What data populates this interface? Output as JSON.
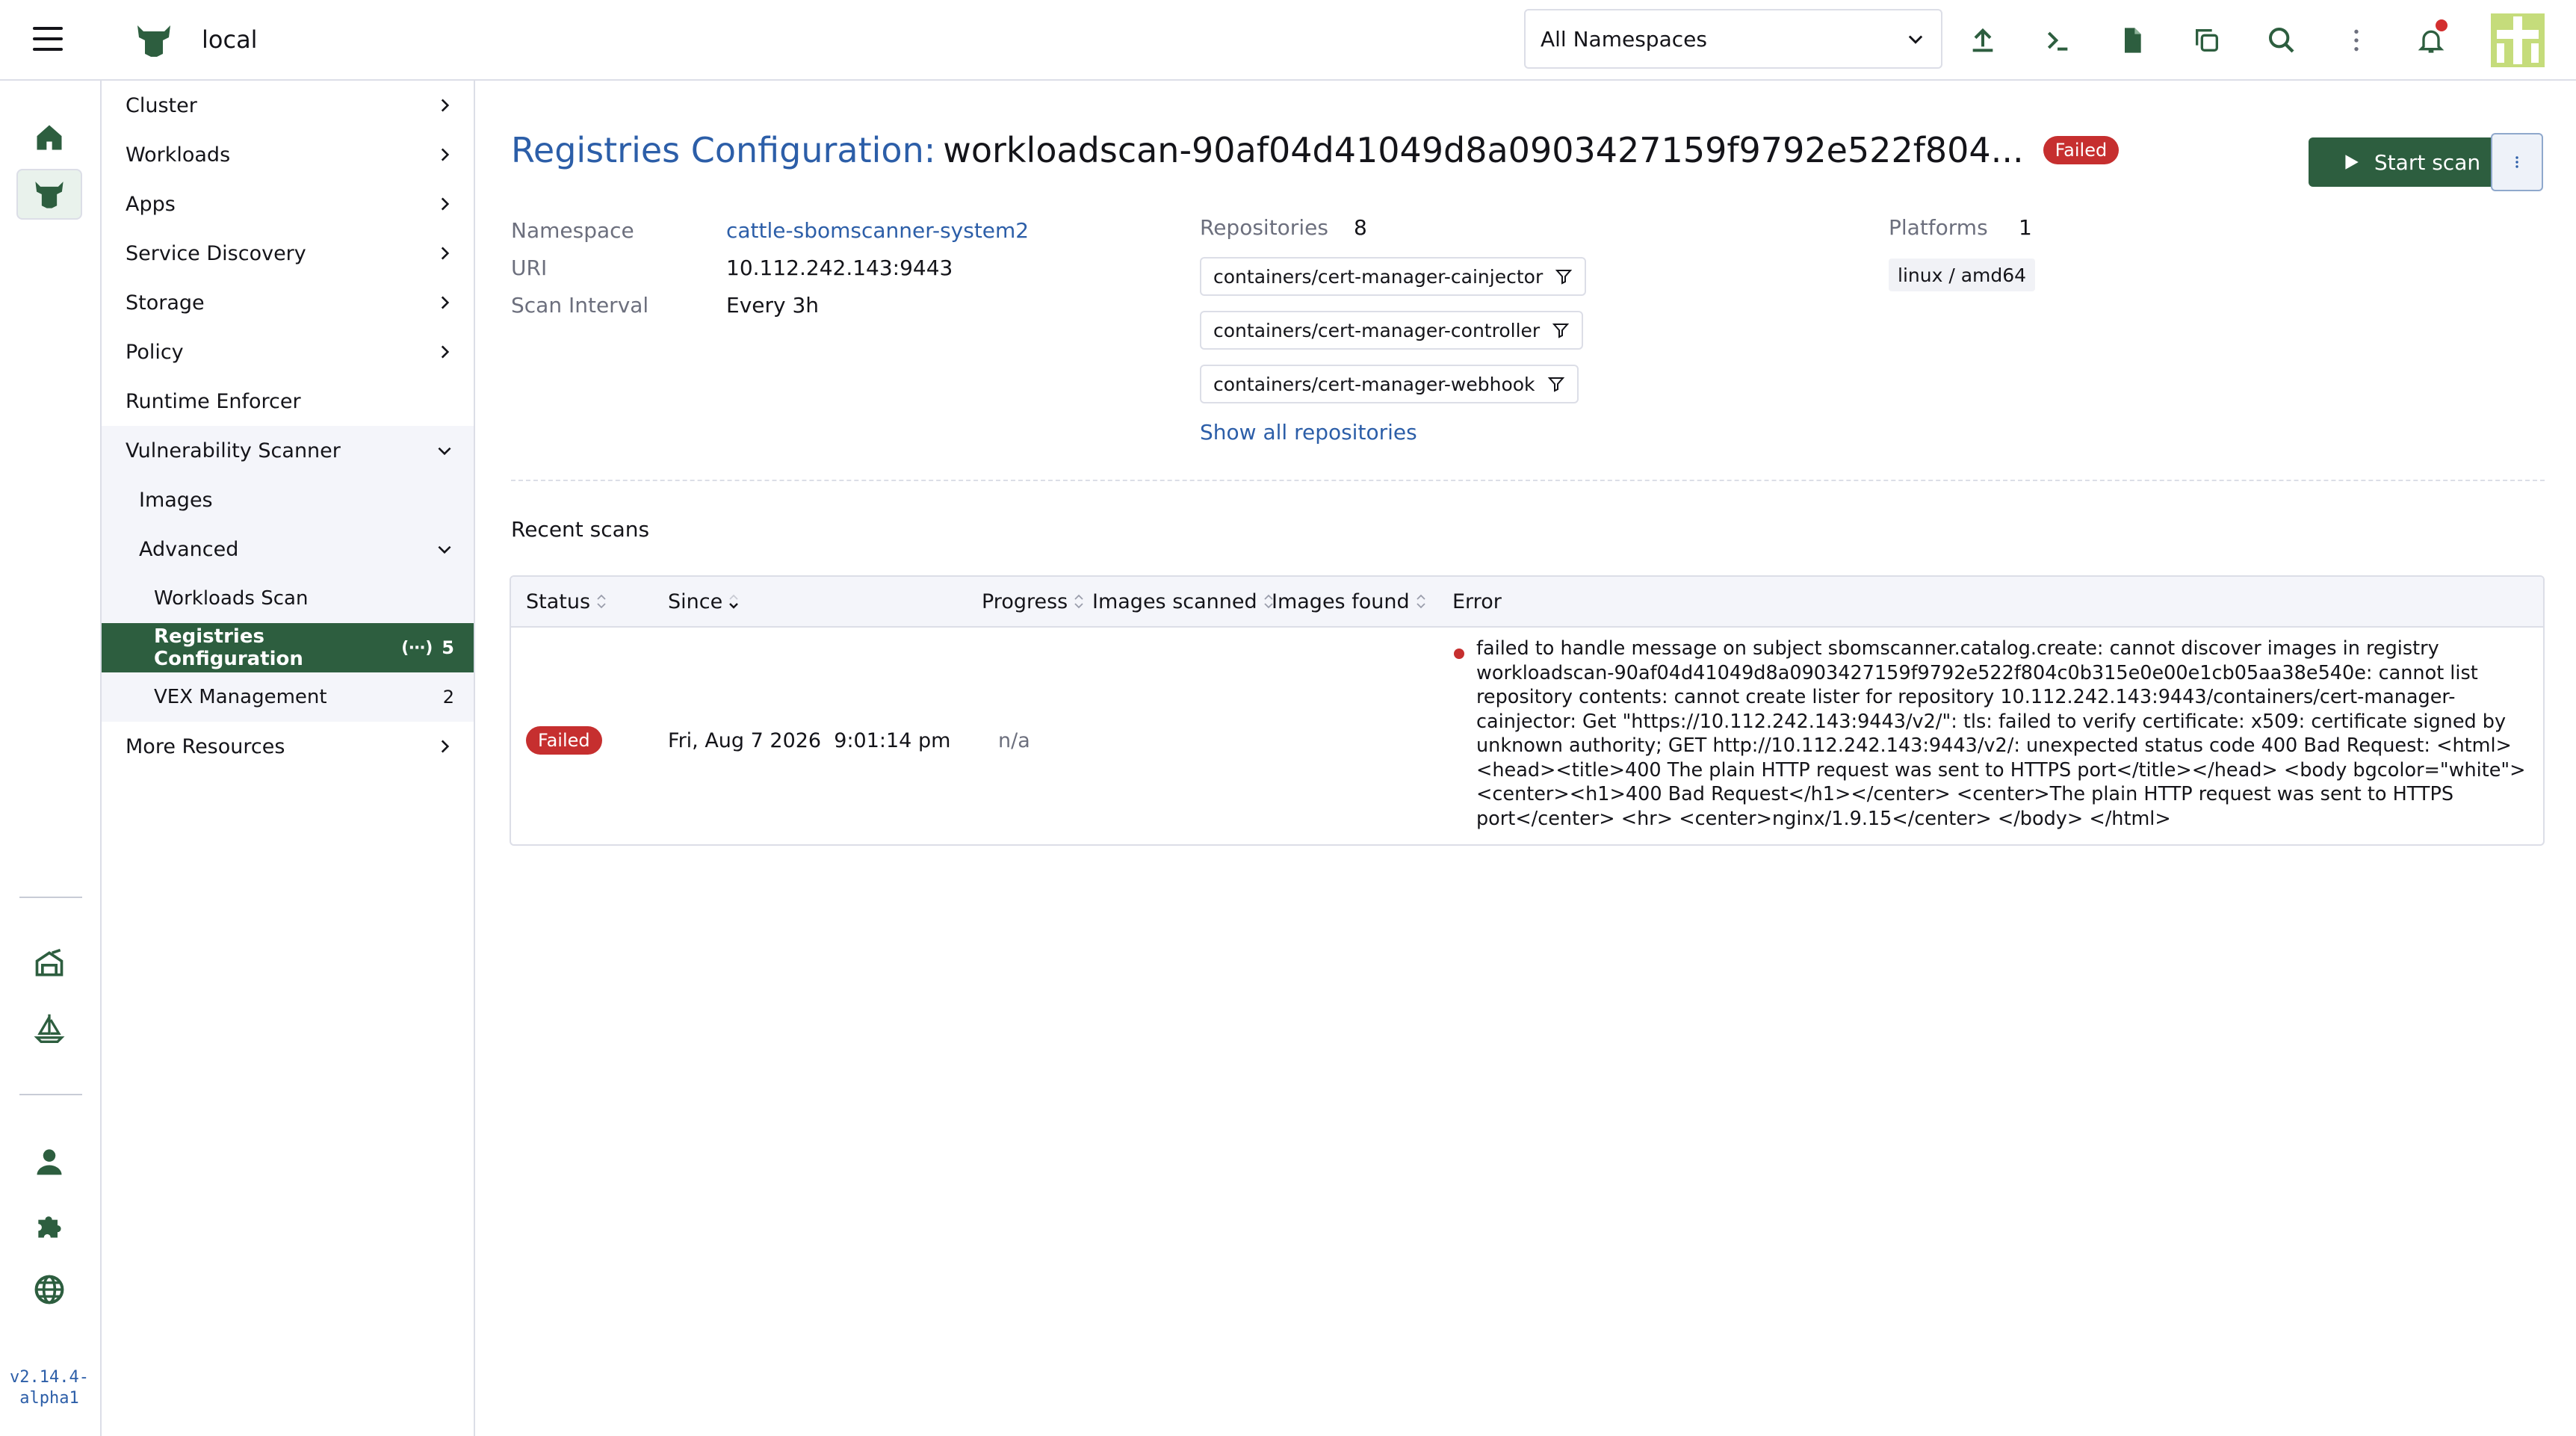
{
  "header": {
    "cluster_name": "local",
    "namespace_select": "All Namespaces",
    "icons": [
      "upload-icon",
      "terminal-icon",
      "file-icon",
      "copy-icon",
      "search-icon",
      "kebab-icon",
      "bell-icon",
      "avatar"
    ]
  },
  "rail": {
    "version": "v2.14.4-alpha1",
    "icons": [
      "home-icon",
      "cluster-icon",
      "fleet-icon",
      "sailboat-icon",
      "user-icon",
      "extensions-icon",
      "globe-icon"
    ]
  },
  "sidenav": {
    "items": [
      {
        "label": "Cluster"
      },
      {
        "label": "Workloads"
      },
      {
        "label": "Apps"
      },
      {
        "label": "Service Discovery"
      },
      {
        "label": "Storage"
      },
      {
        "label": "Policy"
      },
      {
        "label": "Runtime Enforcer"
      },
      {
        "label": "Vulnerability Scanner"
      },
      {
        "label": "Images"
      },
      {
        "label": "Advanced"
      },
      {
        "label": "Workloads Scan"
      },
      {
        "label": "Registries Configuration",
        "count": "5",
        "count_prefix": "(⋯)"
      },
      {
        "label": "VEX Management",
        "count": "2"
      },
      {
        "label": "More Resources"
      }
    ]
  },
  "page": {
    "title_prefix": "Registries Configuration:",
    "title_name": "workloadscan-90af04d41049d8a0903427159f9792e522f804...",
    "status_badge": "Failed",
    "start_scan_label": "Start scan",
    "namespace_label": "Namespace",
    "namespace_value": "cattle-sbomscanner-system2",
    "uri_label": "URI",
    "uri_value": "10.112.242.143:9443",
    "scan_interval_label": "Scan Interval",
    "scan_interval_value": "Every 3h",
    "repositories_label": "Repositories",
    "repositories_count": "8",
    "repositories": [
      "containers/cert-manager-cainjector",
      "containers/cert-manager-controller",
      "containers/cert-manager-webhook"
    ],
    "show_all_label": "Show all repositories",
    "platforms_label": "Platforms",
    "platforms_count": "1",
    "platforms": [
      "linux / amd64"
    ],
    "recent_scans_title": "Recent scans"
  },
  "table": {
    "columns": [
      "Status",
      "Since",
      "Progress",
      "Images scanned",
      "Images found",
      "Error"
    ],
    "rows": [
      {
        "status": "Failed",
        "since": "Fri, Aug 7 2026  9:01:14 pm",
        "progress": "n/a",
        "images_scanned": "",
        "images_found": "",
        "error": "failed to handle message on subject sbomscanner.catalog.create: cannot discover images in registry workloadscan-90af04d41049d8a0903427159f9792e522f804c0b315e0e00e1cb05aa38e540e: cannot list repository contents: cannot create lister for repository 10.112.242.143:9443/containers/cert-manager-cainjector: Get \"https://10.112.242.143:9443/v2/\": tls: failed to verify certificate: x509: certificate signed by unknown authority; GET http://10.112.242.143:9443/v2/: unexpected status code 400 Bad Request: <html> <head><title>400 The plain HTTP request was sent to HTTPS port</title></head> <body bgcolor=\"white\"> <center><h1>400 Bad Request</h1></center> <center>The plain HTTP request was sent to HTTPS port</center> <hr> <center>nginx/1.9.15</center> </body> </html>"
      }
    ]
  },
  "colors": {
    "primary_green": "#2d5e3f",
    "link_blue": "#2c5ea8",
    "error_red": "#c62f2f",
    "border": "#dcdee7"
  }
}
